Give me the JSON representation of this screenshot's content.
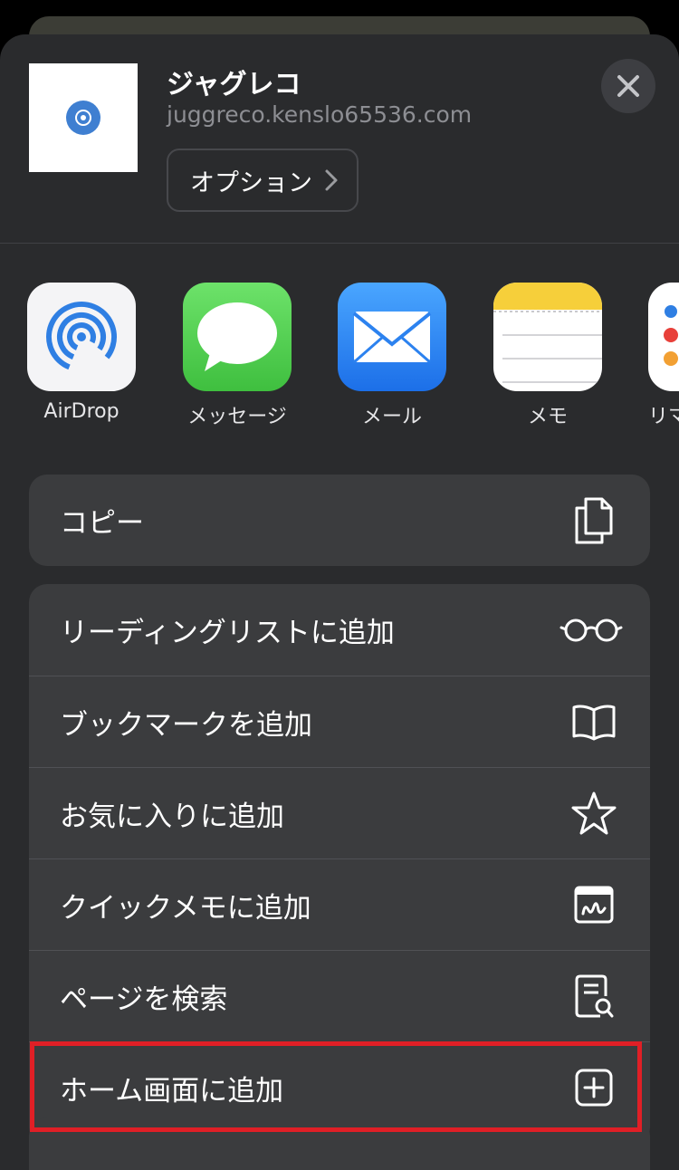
{
  "header": {
    "title": "ジャグレコ",
    "url": "juggreco.kenslo65536.com",
    "options_label": "オプション"
  },
  "apps": [
    {
      "label": "AirDrop",
      "icon": "airdrop-icon"
    },
    {
      "label": "メッセージ",
      "icon": "messages-icon"
    },
    {
      "label": "メール",
      "icon": "mail-icon"
    },
    {
      "label": "メモ",
      "icon": "notes-icon"
    },
    {
      "label": "リマ",
      "icon": "reminders-icon"
    }
  ],
  "copy_group": [
    {
      "label": "コピー",
      "icon": "copy-icon"
    }
  ],
  "actions": [
    {
      "label": "リーディングリストに追加",
      "icon": "glasses-icon"
    },
    {
      "label": "ブックマークを追加",
      "icon": "book-icon"
    },
    {
      "label": "お気に入りに追加",
      "icon": "star-icon"
    },
    {
      "label": "クイックメモに追加",
      "icon": "quick-note-icon"
    },
    {
      "label": "ページを検索",
      "icon": "find-in-page-icon"
    },
    {
      "label": "ホーム画面に追加",
      "icon": "add-square-icon"
    }
  ],
  "colors": {
    "sheet_bg": "#2a2b2d",
    "group_bg": "#3b3c3e",
    "highlight": "#e01f26",
    "messages_green": "#4fc950",
    "mail_blue": "#2f8ff7",
    "notes_yellow": "#f6cf3a"
  }
}
